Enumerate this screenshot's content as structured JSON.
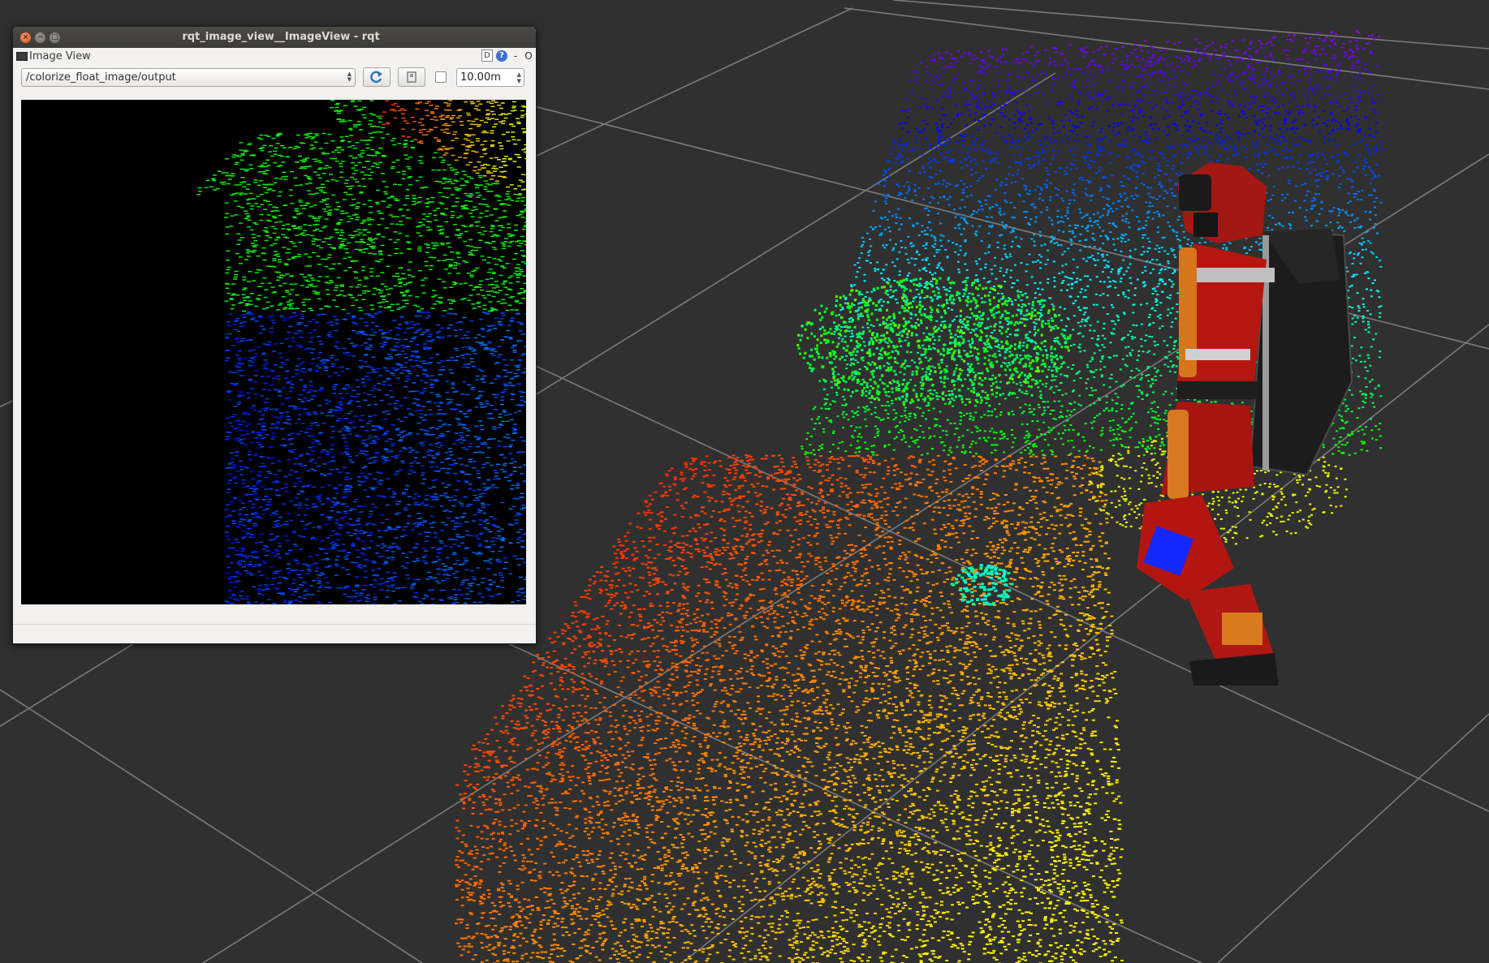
{
  "window": {
    "title": "rqt_image_view__ImageView - rqt",
    "buttons": [
      "close",
      "minimize",
      "maximize"
    ]
  },
  "plugin": {
    "title": "Image View",
    "header_d": "D",
    "header_help": "?",
    "header_min": "-",
    "header_close": "O"
  },
  "toolbar": {
    "topic": "/colorize_float_image/output",
    "refresh_icon": "refresh-icon",
    "save_icon": "save-icon",
    "smooth_scaling": false,
    "max_range": "10.00m"
  },
  "colors": {
    "viewport_bg": "#303030",
    "grid": "#8a8a8a",
    "robot_red": "#b8140f",
    "robot_orange": "#e0781e",
    "robot_dark": "#1e1e1e",
    "robot_blue": "#1428ff"
  }
}
